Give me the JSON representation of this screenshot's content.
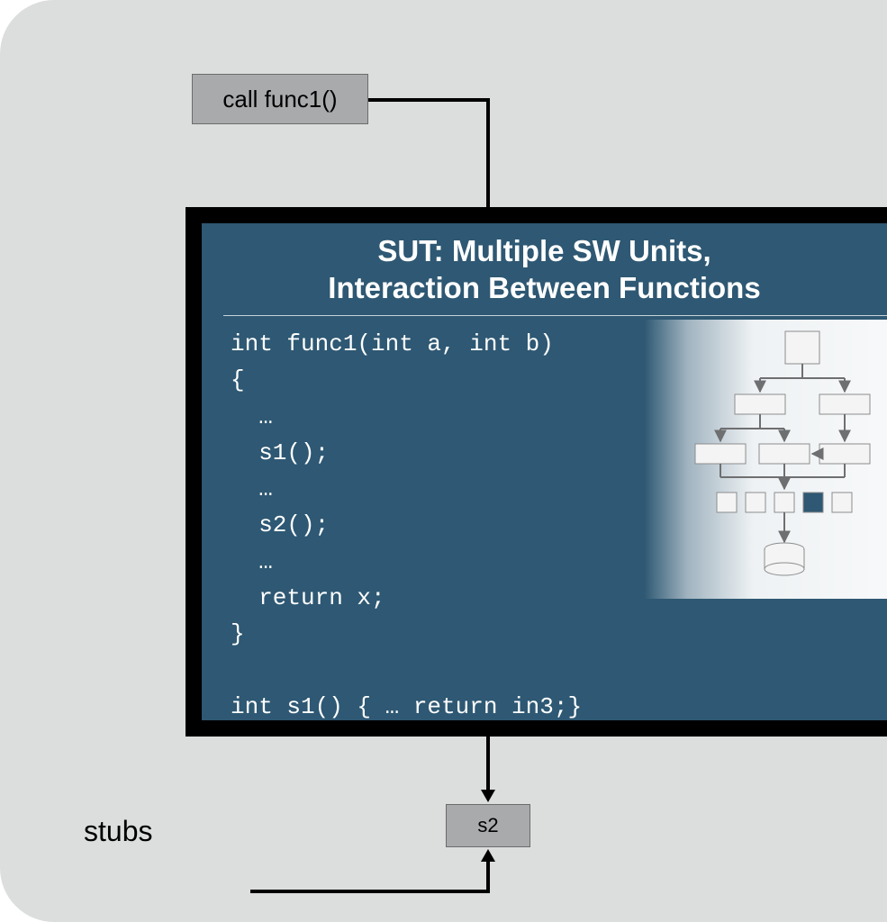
{
  "diagram": {
    "call_box_label": "call func1()",
    "sut_title_line1": "SUT: Multiple SW Units,",
    "sut_title_line2": "Interaction Between Functions",
    "code_lines": [
      "int func1(int a, int b)",
      "{",
      "  …",
      "  s1();",
      "  …",
      "  s2();",
      "  …",
      "  return x;",
      "}",
      "",
      "int s1() { … return in3;}"
    ],
    "stubs_label": "stubs",
    "stub_box_label": "s2"
  },
  "colors": {
    "panel_bg": "#dcdedd",
    "sut_bg": "#2e5873",
    "box_bg": "#a9aaac",
    "text_light": "#ffffff",
    "text_dark": "#000000"
  }
}
